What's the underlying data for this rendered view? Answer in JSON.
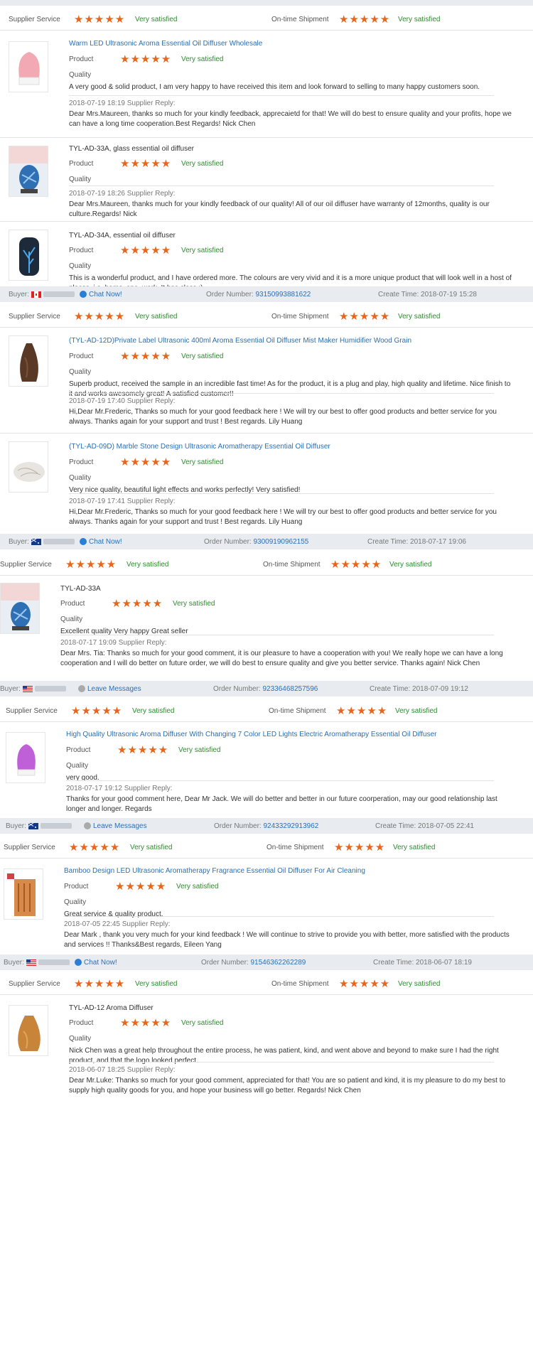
{
  "labels": {
    "supplier_service": "Supplier Service",
    "ontime_shipment": "On-time Shipment",
    "very_satisfied": "Very satisfied",
    "product": "Product",
    "quality": "Quality",
    "supplier_reply": "Supplier Reply:",
    "buyer": "Buyer:",
    "order_number": "Order Number:",
    "create_time": "Create Time:",
    "chat_now": "Chat Now!",
    "leave_messages": "Leave Messages",
    "stars": "★★★★★"
  },
  "colors": {
    "stars": "#e8661c",
    "satisfied": "#2e8b2e",
    "link": "#2a6fb5",
    "band": "#e8ecf0"
  },
  "groups": [
    {
      "reviews": [
        {
          "title": "Warm LED Ultrasonic Aroma Essential Oil Diffuser Wholesale",
          "title_is_link": true,
          "comment": "A very good & solid product, I am very happy to have received this item and look forward to selling to many happy customers soon.",
          "reply_date": "2018-07-19 18:19",
          "reply": "Dear Mrs.Maureen, thanks so much for your kindly feedback, apprecaietd for that! We will do best to ensure quality and your profits, hope we can have a long time cooperation.Best Regards! Nick Chen",
          "thumb_icon": "pink-diffuser-icon"
        },
        {
          "title": "TYL-AD-33A, glass essential oil diffuser",
          "title_is_link": false,
          "comment": "",
          "reply_date": "2018-07-19 18:26",
          "reply": "Dear Mrs.Maureen, thanks much for your kindly feedback of our quality! All of our oil diffuser have warranty of 12months, quality is our culture.Regards! Nick",
          "thumb_icon": "blue-glass-diffuser-icon"
        },
        {
          "title": "TYL-AD-34A, essential oil diffuser",
          "title_is_link": false,
          "comment": "This is a wonderful product, and I have ordered more. The colours are very vivid and it is a more unique product that will look well in a host of places, i.e. home, spa, work. It has class :)",
          "reply_date": "",
          "reply": "",
          "thumb_icon": "black-tree-diffuser-icon"
        }
      ],
      "buyer": {
        "flag": "canada-flag-icon",
        "contact": "Chat Now!",
        "order": "93150993881622",
        "time": "2018-07-19 15:28"
      }
    },
    {
      "reviews": [
        {
          "title": "(TYL-AD-12D)Private Label Ultrasonic 400ml Aroma Essential Oil Diffuser Mist Maker Humidifier Wood Grain",
          "title_is_link": true,
          "comment": "Superb product, received the sample in an incredible fast time! As for the product, it is a plug and play, high quality and lifetime. Nice finish to it and works awesomely great! A satisfied customer!!",
          "reply_date": "2018-07-19 17:40",
          "reply": "Hi,Dear Mr.Frederic, Thanks so much for your good feedback here ! We will try our best to offer good products and better service for you always. Thanks again for your support and trust ! Best regards. Lily Huang",
          "thumb_icon": "wood-grain-diffuser-icon"
        },
        {
          "title": "(TYL-AD-09D) Marble Stone Design Ultrasonic Aromatherapy Essential Oil Diffuser",
          "title_is_link": true,
          "comment": "Very nice quality, beautiful light effects and works perfectly! Very satisfied!",
          "reply_date": "2018-07-19 17:41",
          "reply": "Hi,Dear Mr.Frederic, Thanks so much for your good feedback here ! We will try our best to offer good products and better service for you always. Thanks again for your support and trust ! Best regards. Lily Huang",
          "thumb_icon": "marble-diffuser-icon"
        }
      ],
      "buyer": {
        "flag": "australia-flag-icon",
        "contact": "Chat Now!",
        "order": "93009190962155",
        "time": "2018-07-17 19:06"
      }
    },
    {
      "reviews": [
        {
          "title": "TYL-AD-33A",
          "title_is_link": false,
          "comment": "Excellent quality Very happy Great seller",
          "reply_date": "2018-07-17 19:09",
          "reply": "Dear Mrs. Tia: Thanks so much for your good comment, it is our pleasure to have a cooperation with you! We really hope we can have a long cooperation and I will do better on future order, we will do best to ensure quality and give you better service. Thanks again! Nick Chen",
          "thumb_icon": "blue-glass-diffuser-icon"
        }
      ],
      "buyer": {
        "flag": "usa-flag-icon",
        "contact": "Leave Messages",
        "order": "92336468257596",
        "time": "2018-07-09 19:12"
      }
    },
    {
      "reviews": [
        {
          "title": "High Quality Ultrasonic Aroma Diffuser With Changing 7 Color LED Lights Electric Aromatherapy Essential Oil Diffuser",
          "title_is_link": true,
          "comment": "very good.",
          "reply_date": "2018-07-17 19:12",
          "reply": "Thanks for your good comment here, Dear Mr Jack. We will do better and better in our future coorperation, may our good relationship last longer and longer. Regards",
          "thumb_icon": "purple-led-diffuser-icon"
        }
      ],
      "buyer": {
        "flag": "australia-flag-icon",
        "contact": "Leave Messages",
        "order": "92433292913962",
        "time": "2018-07-05 22:41"
      }
    },
    {
      "reviews": [
        {
          "title": "Bamboo Design LED Ultrasonic Aromatherapy Fragrance Essential Oil Diffuser For Air Cleaning",
          "title_is_link": true,
          "comment": "Great service & quality product.",
          "reply_date": "2018-07-05 22:45",
          "reply": "Dear Mark , thank you very much for your kind feedback ! We will continue to strive to provide you with better, more satisfied with the products and services !! Thanks&Best regards, Eileen Yang",
          "thumb_icon": "bamboo-diffuser-icon"
        }
      ],
      "buyer": {
        "flag": "usa-flag-icon",
        "contact": "Chat Now!",
        "order": "91546362262289",
        "time": "2018-06-07 18:19"
      }
    },
    {
      "reviews": [
        {
          "title": "TYL-AD-12 Aroma Diffuser",
          "title_is_link": false,
          "comment": "Nick Chen was a great help throughout the entire process, he was patient, kind, and went above and beyond to make sure I had the right product, and that the logo looked perfect.",
          "reply_date": "2018-06-07 18:25",
          "reply": "Dear Mr.Luke: Thanks so much for your good comment, appreciated for that! You are so patient and kind, it is my pleasure to do my best to supply high quality goods for you, and hope your business will go better. Regards! Nick Chen",
          "thumb_icon": "wood-vase-diffuser-icon"
        }
      ],
      "buyer": null
    }
  ]
}
